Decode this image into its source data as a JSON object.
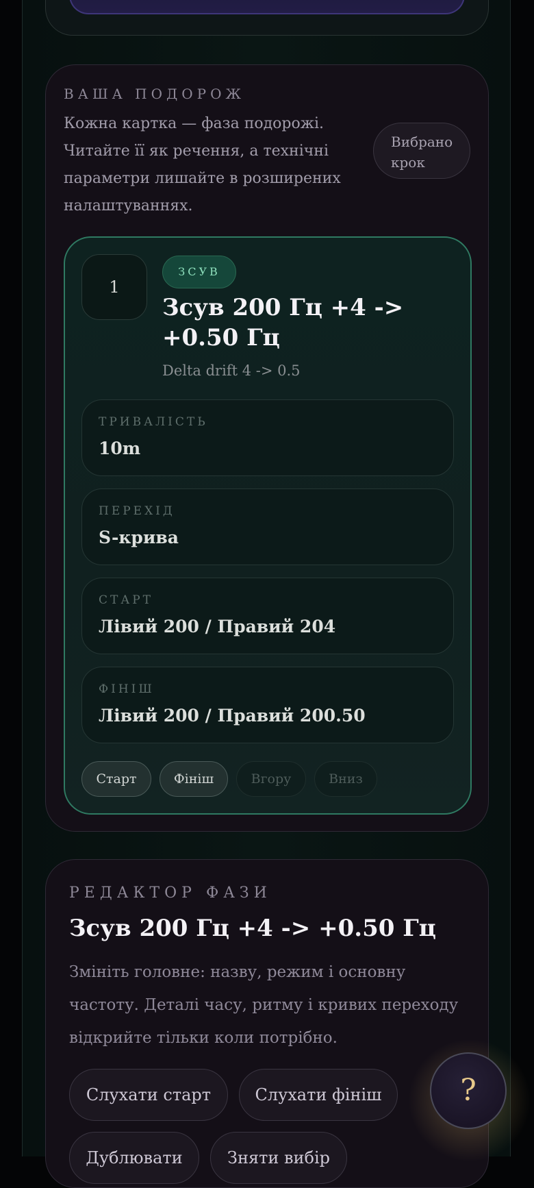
{
  "journey": {
    "eyebrow": "ВАША ПОДОРОЖ",
    "description": "Кожна картка — фаза подорожі. Читайте її як речення, а технічні параметри лишайте в розширених налаштуваннях.",
    "selected_label": "Вибрано крок"
  },
  "step": {
    "number": "1",
    "tag": "ЗСУВ",
    "title": "Зсув 200 Гц +4 -> +0.50 Гц",
    "subtitle": "Delta drift 4 -> 0.5",
    "params": [
      {
        "label": "ТРИВАЛІСТЬ",
        "value": "10m"
      },
      {
        "label": "ПЕРЕХІД",
        "value": "S-крива"
      },
      {
        "label": "СТАРТ",
        "value": "Лівий 200 / Правий 204"
      },
      {
        "label": "ФІНІШ",
        "value": "Лівий 200 / Правий 200.50"
      }
    ],
    "actions": {
      "start": "Старт",
      "finish": "Фініш",
      "up": "Вгору",
      "down": "Вниз"
    }
  },
  "editor": {
    "eyebrow": "РЕДАКТОР ФАЗИ",
    "title": "Зсув 200 Гц +4 -> +0.50 Гц",
    "description": "Змініть головне: назву, режим і основну частоту. Деталі часу, ритму і кривих переходу відкрийте тільки коли потрібно.",
    "buttons": {
      "listen_start": "Слухати старт",
      "listen_finish": "Слухати фініш",
      "duplicate": "Дублювати",
      "clear_selection": "Зняти вибір"
    }
  },
  "help": {
    "label": "?"
  },
  "colors": {
    "accent_green": "#2f7a62",
    "tag_text": "#8fe0bd",
    "help_glyph": "#e8c98a"
  }
}
